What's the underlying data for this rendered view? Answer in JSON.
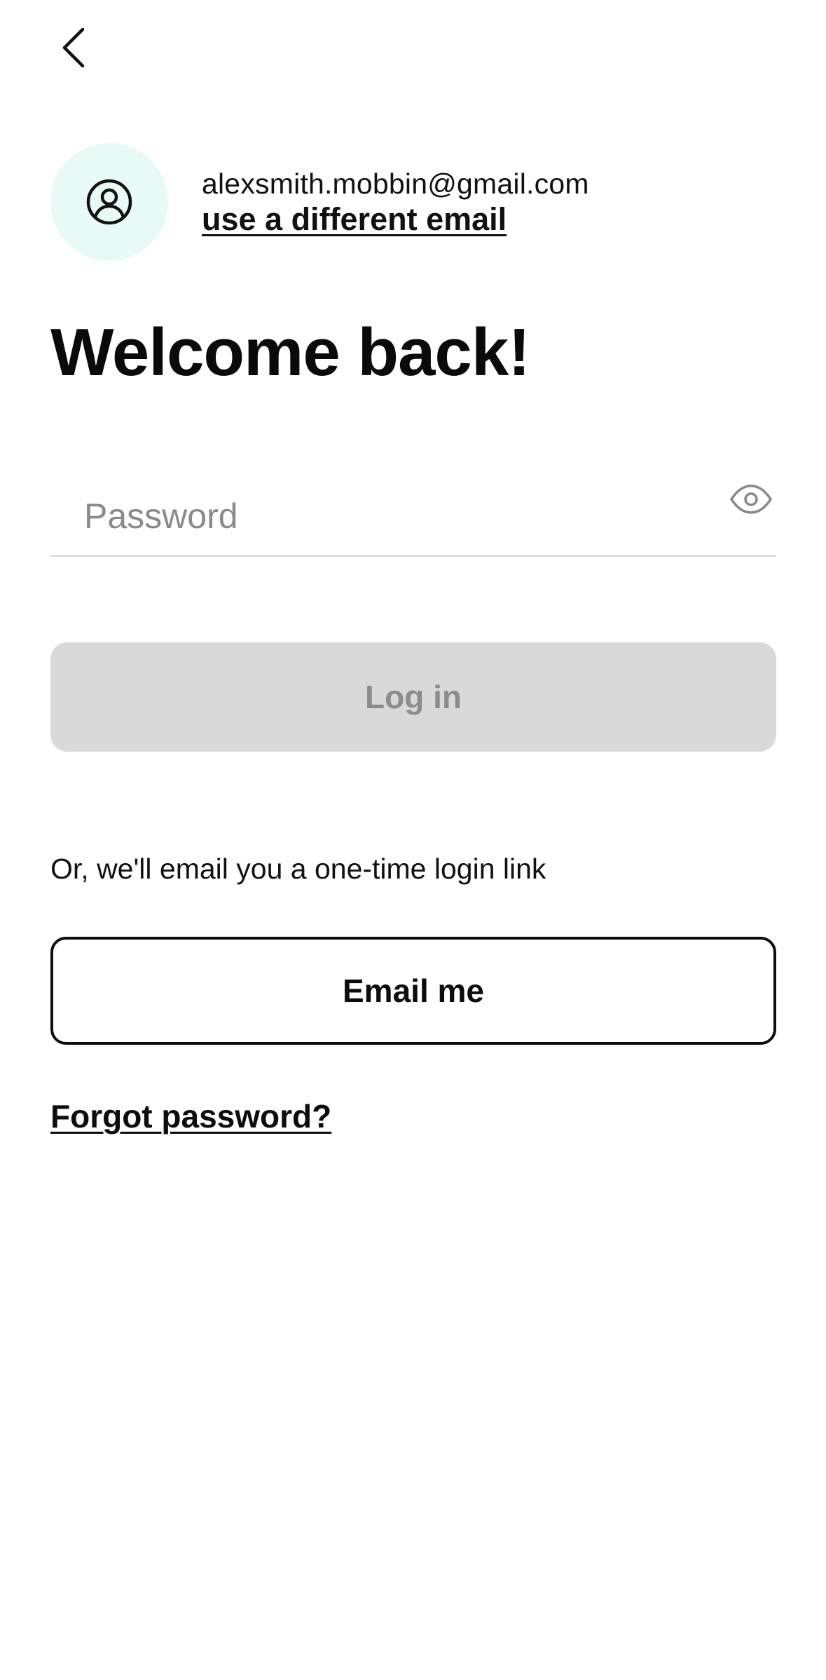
{
  "header": {
    "back_icon": "chevron-left-icon"
  },
  "account": {
    "avatar_icon": "user-circle-icon",
    "avatar_bg": "#e8faf6",
    "email": "alexsmith.mobbin@gmail.com",
    "change_email_label": "use a different email"
  },
  "title": "Welcome back!",
  "password": {
    "placeholder": "Password",
    "value": "",
    "toggle_icon": "eye-icon"
  },
  "login_button": {
    "label": "Log in",
    "state": "disabled",
    "bg": "#d9d9d9",
    "text_color": "#8c8c8c"
  },
  "alternative": {
    "text": "Or, we'll email you a one-time login link",
    "email_button_label": "Email me"
  },
  "forgot_password_label": "Forgot password?"
}
